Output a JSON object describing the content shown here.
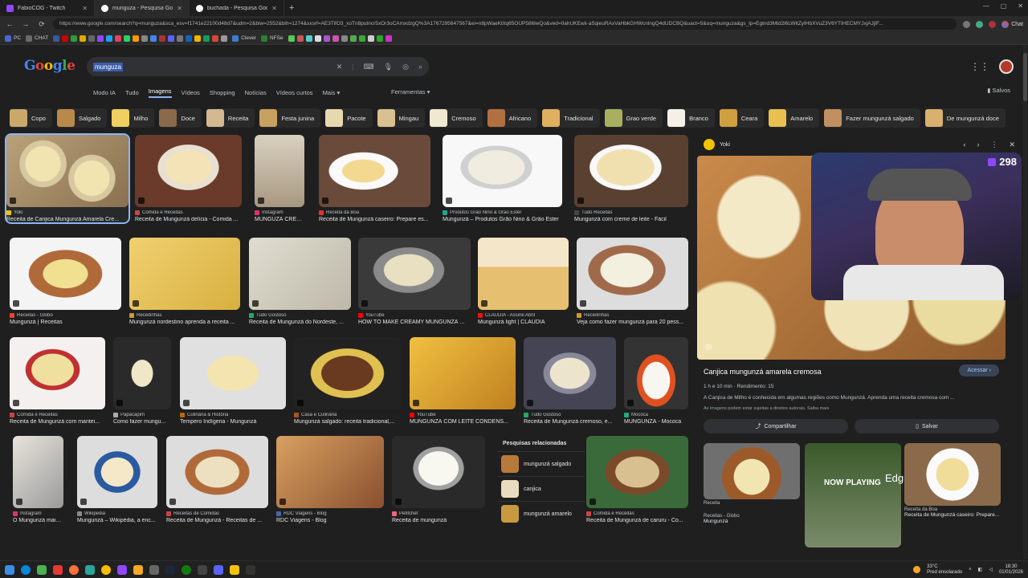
{
  "browser": {
    "tabs": [
      {
        "title": "FabioCOG - Twitch",
        "color": "#9146ff",
        "active": false
      },
      {
        "title": "munguza - Pesquisa Google",
        "color": "#ffffff",
        "active": true
      },
      {
        "title": "buchada - Pesquisa Google",
        "color": "#ffffff",
        "active": false
      }
    ],
    "url": "https://www.google.com/search?q=munguza&sca_esv=f1741e22100d48d7&udm=2&biw=2552&bih=1274&sxsrf=AE3TifO3_xoTn8putncr5xOr3oCAmxdzgQ%3A1767295647567&ei=n8pWaeKtItq65OUP586lwQo&ved=0ahUKEwii-aSqieuRAxVaHbkGHWcnlngQ4dUDCBQ&uact=5&oq=munguza&gs_lp=Egtnd3Mtd2l6LWltZyIHbXVuZ3V6YTIHECMYJxjAJjIF...",
    "chat_label": "Chat",
    "bookmarks": [
      "PC",
      "CHAT",
      "Clever",
      "NFSe"
    ]
  },
  "google": {
    "logo": "Google",
    "query": "munguza",
    "nav": [
      "Modo IA",
      "Tudo",
      "Imagens",
      "Vídeos",
      "Shopping",
      "Notícias",
      "Vídeos curtos",
      "Mais ▾"
    ],
    "tools": "Ferramentas ▾",
    "saved": "Salvos",
    "chips": [
      "Copo",
      "Salgado",
      "Milho",
      "Doce",
      "Receita",
      "Festa junina",
      "Pacote",
      "Mingau",
      "Cremoso",
      "Africano",
      "Tradicional",
      "Grao verde",
      "Branco",
      "Ceara",
      "Amarelo",
      "Fazer mungunzá salgado",
      "De mungunzá doce"
    ]
  },
  "results": [
    {
      "src": "Yoki",
      "title": "Receita de Canjica Mungunzá Amarela Cre..."
    },
    {
      "src": "Comida e Receitas",
      "title": "Receita de Mungunzá delícia - Comida ..."
    },
    {
      "src": "Instagram",
      "title": "MUNGUZÁ CREM..."
    },
    {
      "src": "Receita da Boa",
      "title": "Receita de Mungunzá caseiro: Prepare es..."
    },
    {
      "src": "Produtos Grão Nino & Grão Ester",
      "title": "Mungunzá – Produtos Grão Nino & Grão Ester"
    },
    {
      "src": "Tudo Receitas",
      "title": "Mungunzá com creme de leite - Fácil"
    },
    {
      "src": "Receitas - Globo",
      "title": "Mungunzá | Receitas"
    },
    {
      "src": "Receitinhas",
      "title": "Mungunzá nordestino aprenda a receita ..."
    },
    {
      "src": "Tudo Gostoso",
      "title": "Receita de Mungunzá do Nordeste, ..."
    },
    {
      "src": "YouTube",
      "title": "HOW TO MAKE CREAMY MUNGUNZÁ ..."
    },
    {
      "src": "CLAUDIA - Assine Abril",
      "title": "Mungunzá light | CLAUDIA"
    },
    {
      "src": "Receitinhas",
      "title": "Veja como fazer mungunzá para 20 pess..."
    },
    {
      "src": "Comida e Receitas",
      "title": "Receita de Mungunzá com mantei..."
    },
    {
      "src": "Papacapim",
      "title": "Como fazer mungu..."
    },
    {
      "src": "Culinária & História",
      "title": "Tempero Indígena - Mungunzá"
    },
    {
      "src": "Casa e Culinária",
      "title": "Mungunzá salgado: receita tradicional,..."
    },
    {
      "src": "YouTube",
      "title": "MUNGUNZÁ COM LEITE CONDENS..."
    },
    {
      "src": "Tudo Gostoso",
      "title": "Receita de Mungunzá cremoso, e..."
    },
    {
      "src": "Mococa",
      "title": "MUNGUNZÁ - Mococa"
    },
    {
      "src": "Instagram",
      "title": "O Mungunzá mais f..."
    },
    {
      "src": "Wikipedia",
      "title": "Mungunzá – Wikipédia, a enc..."
    },
    {
      "src": "Receitas de Comidas",
      "title": "Receita de Mungunzá - Receitas de ..."
    },
    {
      "src": "RDC Viagens - Blog",
      "title": "RDC Viagens - Blog"
    },
    {
      "src": "Petitchef",
      "title": "Receita de mungunzá"
    },
    {
      "src": "Comida e Receitas",
      "title": "Receita de Mungunzá de caruru - Co..."
    }
  ],
  "related": {
    "heading": "Pesquisas relacionadas",
    "items": [
      "mungunzá salgado",
      "canjica",
      "mungunzá amarelo"
    ]
  },
  "panel": {
    "source": "Yoki",
    "title": "Canjica mungunzá amarela cremosa",
    "visit": "Acessar ›",
    "meta": "1 h e 10 min · Rendimento: 15",
    "desc": "A Canjica de Milho é conhecida em algumas regiões como Mungunzá. Aprenda uma receita cremosa com ...",
    "note": "As imagens podem estar sujeitas a direitos autorais. Saiba mais",
    "share": "Compartilhar",
    "save": "Salvar",
    "more": [
      {
        "src": "Receita",
        "title": ""
      },
      {
        "src": "Receitas - Globo",
        "title": "Mungunzá"
      },
      {
        "src": "Receita da Boa",
        "title": "Receita de Mungunzá caseiro: Prepare..."
      }
    ],
    "now_playing": "NOW PLAYING",
    "partial": "Edgu"
  },
  "overlay": {
    "viewers": "298"
  },
  "taskbar": {
    "weather_temp": "33°C",
    "weather_desc": "Pred ensolarado",
    "time": "18:30",
    "date": "01/01/2026"
  }
}
